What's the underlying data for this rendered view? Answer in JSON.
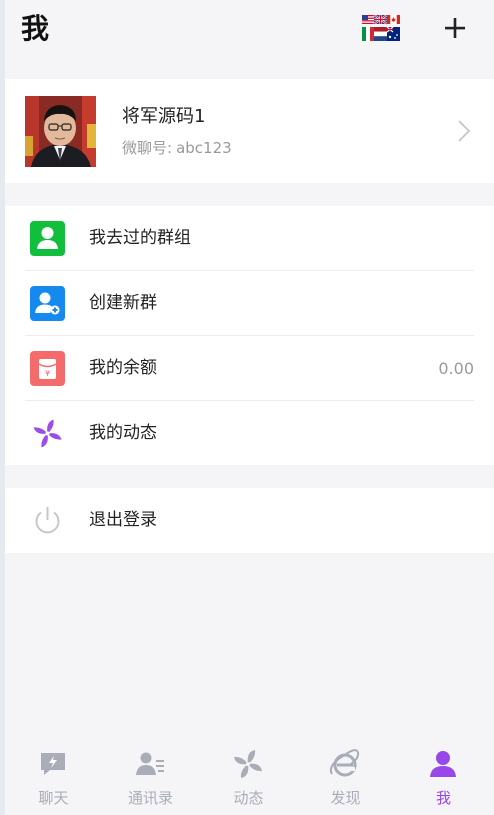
{
  "header": {
    "title": "我",
    "add_icon": "plus-icon",
    "language_icon": "language-flags-icon"
  },
  "profile": {
    "name": "将军源码1",
    "id_label": "微聊号:",
    "id_value": "abc123",
    "avatar": "user-avatar-photo"
  },
  "menu": [
    {
      "label": "我去过的群组",
      "icon": "group-user-icon",
      "color": "#11bf3c"
    },
    {
      "label": "创建新群",
      "icon": "create-group-icon",
      "color": "#1689ef"
    },
    {
      "label": "我的余额",
      "icon": "red-packet-icon",
      "color": "#f46b6b",
      "value": "0.00"
    },
    {
      "label": "我的动态",
      "icon": "pinwheel-icon",
      "color": "#9b4de8"
    }
  ],
  "logout": {
    "label": "退出登录",
    "icon": "power-icon"
  },
  "bottom_nav": [
    {
      "label": "聊天",
      "icon": "chat-icon"
    },
    {
      "label": "通讯录",
      "icon": "contacts-icon"
    },
    {
      "label": "动态",
      "icon": "moments-icon"
    },
    {
      "label": "发现",
      "icon": "discover-icon"
    },
    {
      "label": "我",
      "icon": "me-icon",
      "active": true
    }
  ],
  "colors": {
    "accent": "#9747ea",
    "inactive": "#a8adb8",
    "background": "#f5f5f7"
  }
}
